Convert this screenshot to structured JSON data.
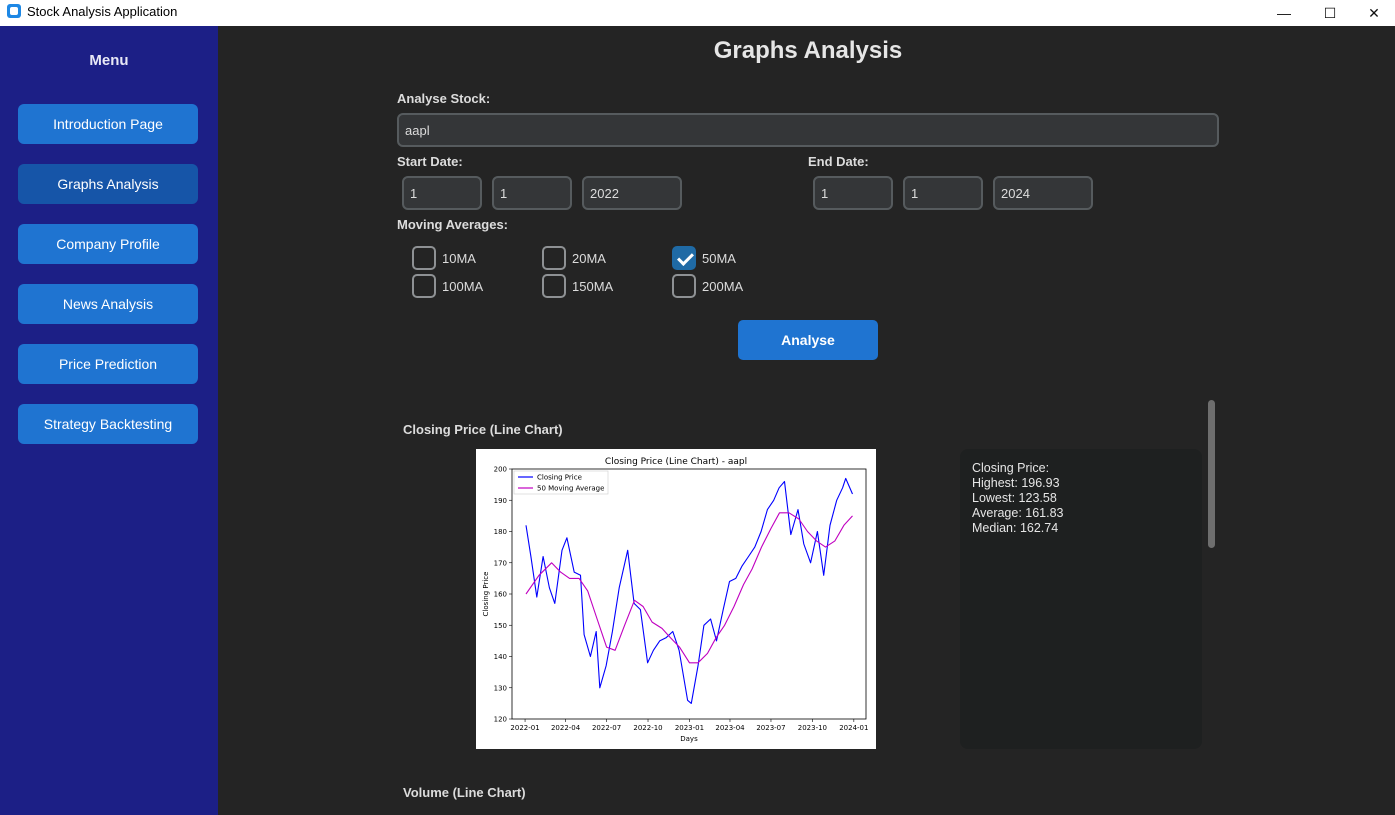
{
  "window": {
    "title": "Stock Analysis Application",
    "minimize": "—",
    "maximize": "☐",
    "close": "✕"
  },
  "sidebar": {
    "title": "Menu",
    "items": [
      {
        "label": "Introduction Page"
      },
      {
        "label": "Graphs Analysis"
      },
      {
        "label": "Company Profile"
      },
      {
        "label": "News Analysis"
      },
      {
        "label": "Price Prediction"
      },
      {
        "label": "Strategy Backtesting"
      }
    ]
  },
  "main": {
    "title": "Graphs Analysis",
    "stock_label": "Analyse Stock:",
    "stock_value": "aapl",
    "start_label": "Start Date:",
    "start": {
      "day": "1",
      "month": "1",
      "year": "2022"
    },
    "end_label": "End Date:",
    "end": {
      "day": "1",
      "month": "1",
      "year": "2024"
    },
    "ma_label": "Moving Averages:",
    "ma": [
      {
        "label": "10MA",
        "checked": false
      },
      {
        "label": "20MA",
        "checked": false
      },
      {
        "label": "50MA",
        "checked": true
      },
      {
        "label": "100MA",
        "checked": false
      },
      {
        "label": "150MA",
        "checked": false
      },
      {
        "label": "200MA",
        "checked": false
      }
    ],
    "analyse_button": "Analyse",
    "section1_title": "Closing Price (Line Chart)",
    "section2_title": "Volume (Line Chart)",
    "stats": {
      "heading": "Closing Price:",
      "highest": "Highest: 196.93",
      "lowest": "Lowest: 123.58",
      "average": "Average: 161.83",
      "median": "Median: 162.74"
    }
  },
  "chart_data": {
    "type": "line",
    "title": "Closing Price (Line Chart) - aapl",
    "xlabel": "Days",
    "ylabel": "Closing Price",
    "ylim": [
      120,
      200
    ],
    "yticks": [
      120,
      130,
      140,
      150,
      160,
      170,
      180,
      190,
      200
    ],
    "xticks": [
      "2022-01",
      "2022-04",
      "2022-07",
      "2022-10",
      "2023-01",
      "2023-04",
      "2023-07",
      "2023-10",
      "2024-01"
    ],
    "legend": "top-left",
    "series": [
      {
        "name": "Closing Price",
        "color": "#0000ff",
        "points": [
          [
            "2022-01-03",
            182
          ],
          [
            "2022-01-14",
            172
          ],
          [
            "2022-01-27",
            159
          ],
          [
            "2022-02-10",
            172
          ],
          [
            "2022-02-24",
            162
          ],
          [
            "2022-03-08",
            157
          ],
          [
            "2022-03-24",
            174
          ],
          [
            "2022-04-04",
            178
          ],
          [
            "2022-04-20",
            167
          ],
          [
            "2022-05-04",
            166
          ],
          [
            "2022-05-12",
            147
          ],
          [
            "2022-05-26",
            140
          ],
          [
            "2022-06-08",
            148
          ],
          [
            "2022-06-16",
            130
          ],
          [
            "2022-06-30",
            137
          ],
          [
            "2022-07-14",
            148
          ],
          [
            "2022-07-29",
            162
          ],
          [
            "2022-08-17",
            174
          ],
          [
            "2022-08-31",
            157
          ],
          [
            "2022-09-14",
            155
          ],
          [
            "2022-09-30",
            138
          ],
          [
            "2022-10-13",
            142
          ],
          [
            "2022-10-27",
            145
          ],
          [
            "2022-11-10",
            146
          ],
          [
            "2022-11-25",
            148
          ],
          [
            "2022-12-09",
            142
          ],
          [
            "2022-12-28",
            126
          ],
          [
            "2023-01-05",
            125
          ],
          [
            "2023-01-20",
            137
          ],
          [
            "2023-02-02",
            150
          ],
          [
            "2023-02-17",
            152
          ],
          [
            "2023-03-02",
            145
          ],
          [
            "2023-03-17",
            155
          ],
          [
            "2023-03-31",
            164
          ],
          [
            "2023-04-14",
            165
          ],
          [
            "2023-04-28",
            169
          ],
          [
            "2023-05-12",
            172
          ],
          [
            "2023-05-26",
            175
          ],
          [
            "2023-06-09",
            180
          ],
          [
            "2023-06-23",
            187
          ],
          [
            "2023-07-07",
            190
          ],
          [
            "2023-07-19",
            194
          ],
          [
            "2023-07-31",
            196
          ],
          [
            "2023-08-14",
            179
          ],
          [
            "2023-08-30",
            187
          ],
          [
            "2023-09-12",
            176
          ],
          [
            "2023-09-27",
            170
          ],
          [
            "2023-10-12",
            180
          ],
          [
            "2023-10-26",
            166
          ],
          [
            "2023-11-09",
            182
          ],
          [
            "2023-11-24",
            190
          ],
          [
            "2023-12-07",
            194
          ],
          [
            "2023-12-14",
            197
          ],
          [
            "2023-12-29",
            192
          ]
        ]
      },
      {
        "name": "50 Moving Average",
        "color": "#c000c0",
        "points": [
          [
            "2022-01-03",
            160
          ],
          [
            "2022-02-01",
            166
          ],
          [
            "2022-03-01",
            170
          ],
          [
            "2022-03-21",
            167
          ],
          [
            "2022-04-10",
            165
          ],
          [
            "2022-05-01",
            165
          ],
          [
            "2022-05-20",
            161
          ],
          [
            "2022-06-10",
            152
          ],
          [
            "2022-07-01",
            143
          ],
          [
            "2022-07-20",
            142
          ],
          [
            "2022-08-10",
            150
          ],
          [
            "2022-09-01",
            158
          ],
          [
            "2022-09-20",
            156
          ],
          [
            "2022-10-10",
            151
          ],
          [
            "2022-11-01",
            149
          ],
          [
            "2022-11-20",
            146
          ],
          [
            "2022-12-10",
            143
          ],
          [
            "2023-01-01",
            138
          ],
          [
            "2023-01-20",
            138
          ],
          [
            "2023-02-10",
            141
          ],
          [
            "2023-03-01",
            146
          ],
          [
            "2023-03-20",
            150
          ],
          [
            "2023-04-10",
            156
          ],
          [
            "2023-05-01",
            163
          ],
          [
            "2023-05-20",
            168
          ],
          [
            "2023-06-10",
            175
          ],
          [
            "2023-07-01",
            181
          ],
          [
            "2023-07-20",
            186
          ],
          [
            "2023-08-10",
            186
          ],
          [
            "2023-09-01",
            184
          ],
          [
            "2023-09-20",
            180
          ],
          [
            "2023-10-10",
            177
          ],
          [
            "2023-10-30",
            175
          ],
          [
            "2023-11-20",
            177
          ],
          [
            "2023-12-10",
            182
          ],
          [
            "2023-12-29",
            185
          ]
        ]
      }
    ]
  }
}
